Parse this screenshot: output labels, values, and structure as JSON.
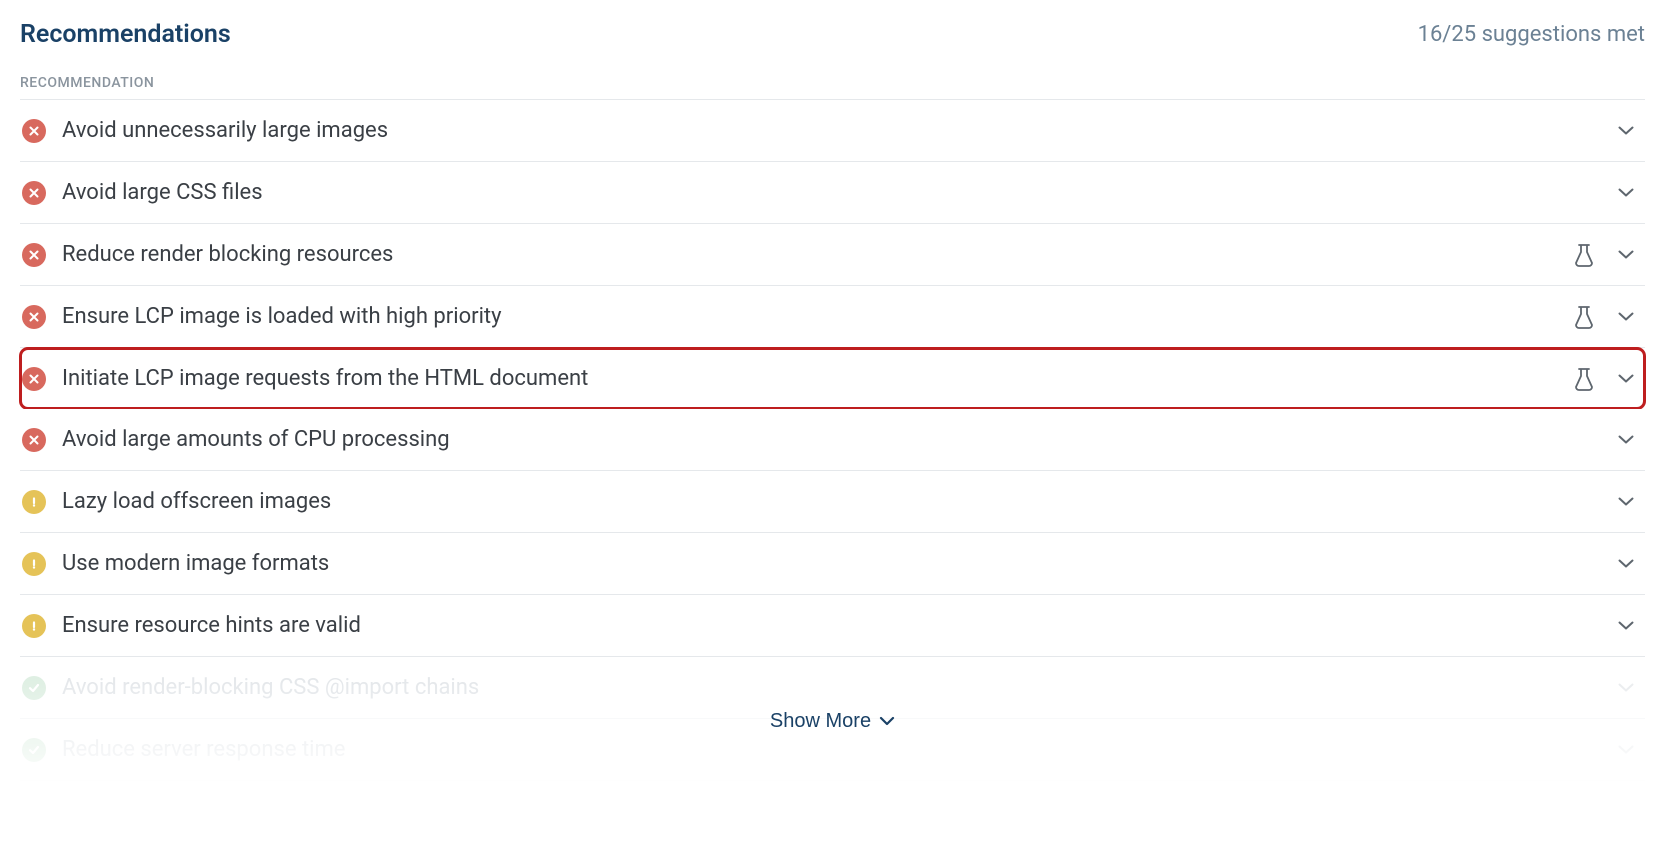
{
  "header": {
    "title": "Recommendations",
    "suggestions_met": "16/25 suggestions met"
  },
  "column_header": "RECOMMENDATION",
  "recommendations": [
    {
      "status": "fail",
      "label": "Avoid unnecessarily large images",
      "has_beaker": false,
      "highlighted": false
    },
    {
      "status": "fail",
      "label": "Avoid large CSS files",
      "has_beaker": false,
      "highlighted": false
    },
    {
      "status": "fail",
      "label": "Reduce render blocking resources",
      "has_beaker": true,
      "highlighted": false
    },
    {
      "status": "fail",
      "label": "Ensure LCP image is loaded with high priority",
      "has_beaker": true,
      "highlighted": false
    },
    {
      "status": "fail",
      "label": "Initiate LCP image requests from the HTML document",
      "has_beaker": true,
      "highlighted": true
    },
    {
      "status": "fail",
      "label": "Avoid large amounts of CPU processing",
      "has_beaker": false,
      "highlighted": false
    },
    {
      "status": "warn",
      "label": "Lazy load offscreen images",
      "has_beaker": false,
      "highlighted": false
    },
    {
      "status": "warn",
      "label": "Use modern image formats",
      "has_beaker": false,
      "highlighted": false
    },
    {
      "status": "warn",
      "label": "Ensure resource hints are valid",
      "has_beaker": false,
      "highlighted": false
    }
  ],
  "recommendations_passed": [
    {
      "status": "pass",
      "label": "Avoid render-blocking CSS @import chains"
    },
    {
      "status": "pass",
      "label": "Reduce server response time"
    }
  ],
  "show_more_label": "Show More"
}
